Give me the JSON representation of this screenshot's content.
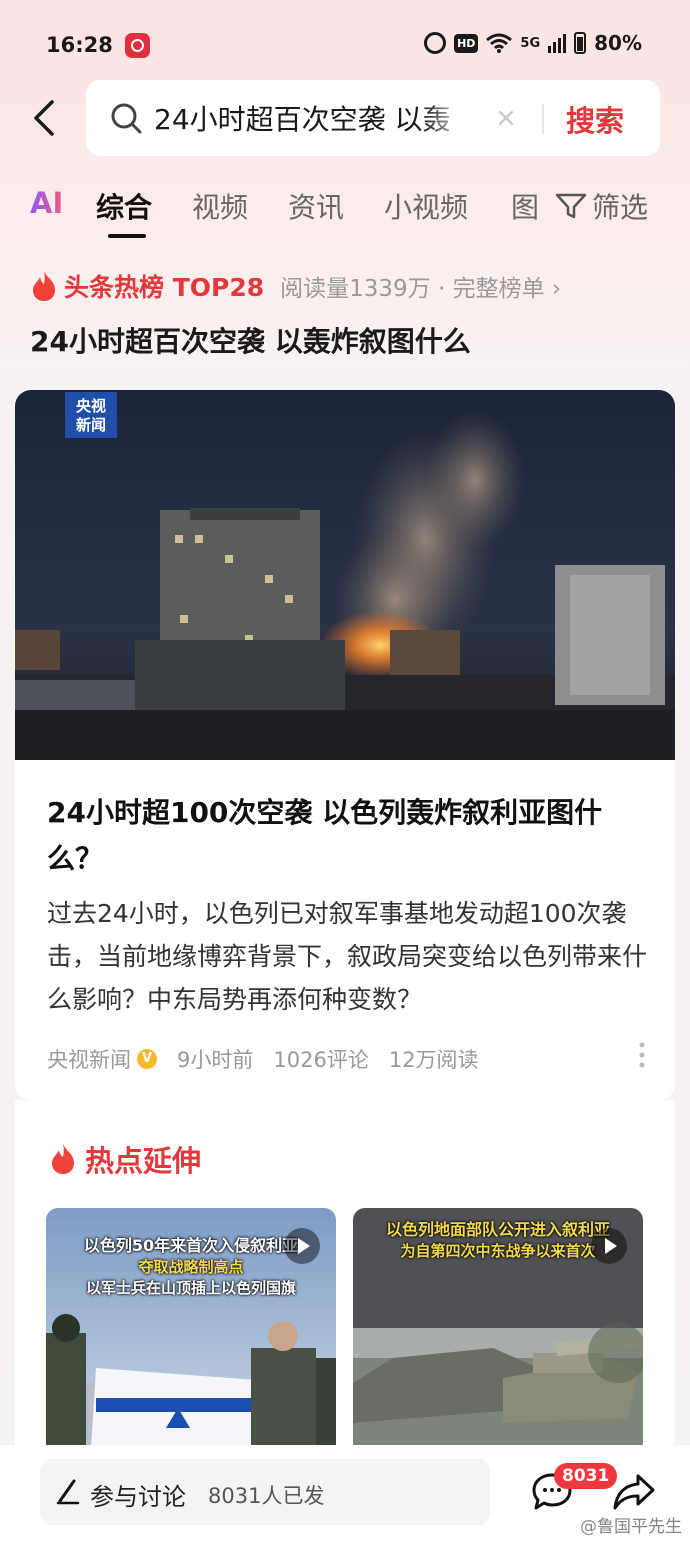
{
  "status_bar": {
    "time": "16:28",
    "signal": "5G",
    "battery": "80%"
  },
  "search": {
    "query": "24小时超百次空袭 以轰",
    "button": "搜索"
  },
  "tabs": {
    "items": [
      "AI",
      "综合",
      "视频",
      "资讯",
      "小视频",
      "图"
    ],
    "active": "综合",
    "filter": "筛选"
  },
  "hot_list": {
    "label": "头条热榜 TOP28",
    "meta": "阅读量1339万 · 完整榜单 ›",
    "title": "24小时超百次空袭 以轰炸叙图什么"
  },
  "article": {
    "image_logo": [
      "央视",
      "新闻"
    ],
    "title": "24小时超100次空袭 以色列轰炸叙利亚图什么？",
    "summary": "过去24小时，以色列已对叙军事基地发动超100次袭击，当前地缘博弈背景下，叙政局突变给以色列带来什么影响？中东局势再添何种变数？",
    "source": "央视新闻",
    "time": "9小时前",
    "comments": "1026评论",
    "reads": "12万阅读"
  },
  "related": {
    "label": "热点延伸",
    "items": [
      {
        "caption_lines": [
          "以色列50年来首次入侵叙利亚",
          "夺取战略制高点",
          "以军士兵在山顶插上以色列国旗"
        ]
      },
      {
        "caption_lines": [
          "以色列地面部队公开进入叙利亚",
          "为自第四次中东战争以来首次"
        ]
      }
    ]
  },
  "bottom_bar": {
    "comment_label": "参与讨论",
    "comment_count": "8031人已发",
    "badge": "8031"
  },
  "watermark": "@鲁国平先生",
  "colors": {
    "accent": "#e4393c",
    "background": "#fbe3e1"
  }
}
